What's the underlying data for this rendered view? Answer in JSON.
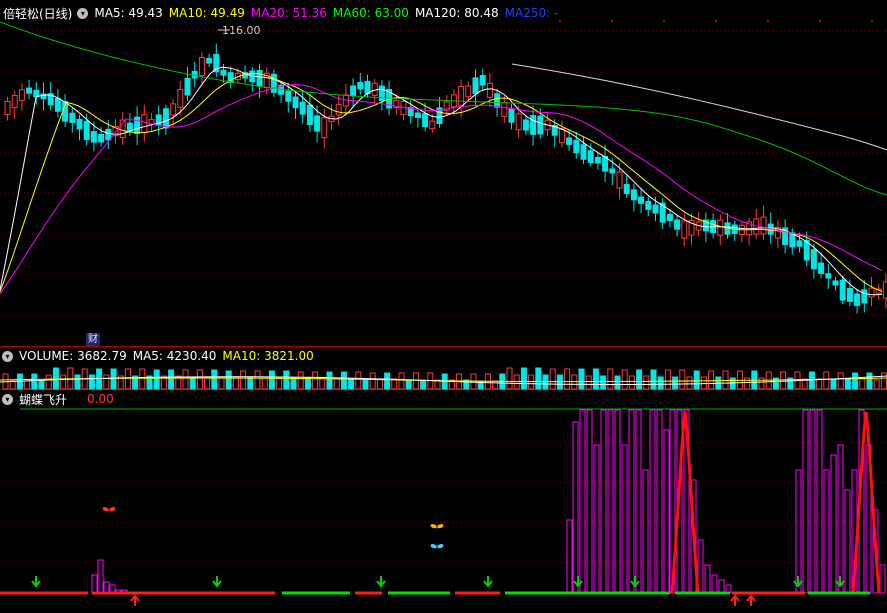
{
  "main_panel": {
    "title": "倍轻松(日线)",
    "collapse_icon": "chevron-down-icon",
    "ma_items": [
      {
        "label": "MA5: 49.43",
        "color": "#ffffff"
      },
      {
        "label": "MA10: 49.49",
        "color": "#ffff00"
      },
      {
        "label": "MA20: 51.36",
        "color": "#ff00ff"
      },
      {
        "label": "MA60: 63.00",
        "color": "#00ff00"
      },
      {
        "label": "MA120: 80.48",
        "color": "#ffffff"
      },
      {
        "label": "MA250: -",
        "color": "#2b3bff"
      }
    ],
    "peak_label": "116.00",
    "finance_badge": "财"
  },
  "volume_panel": {
    "title": "VOLUME: 3682.79",
    "ma5": "MA5: 4230.40",
    "ma10": "MA10: 3821.00"
  },
  "indicator_panel": {
    "title": "蝴蝶飞升",
    "value": "0.00"
  },
  "colors": {
    "up": "#ff3b3b",
    "down": "#00e5e5",
    "grid": "#7a0000",
    "separator": "#b00000",
    "buy_arrow": "#00d400",
    "sell_arrow": "#ff2020"
  }
}
